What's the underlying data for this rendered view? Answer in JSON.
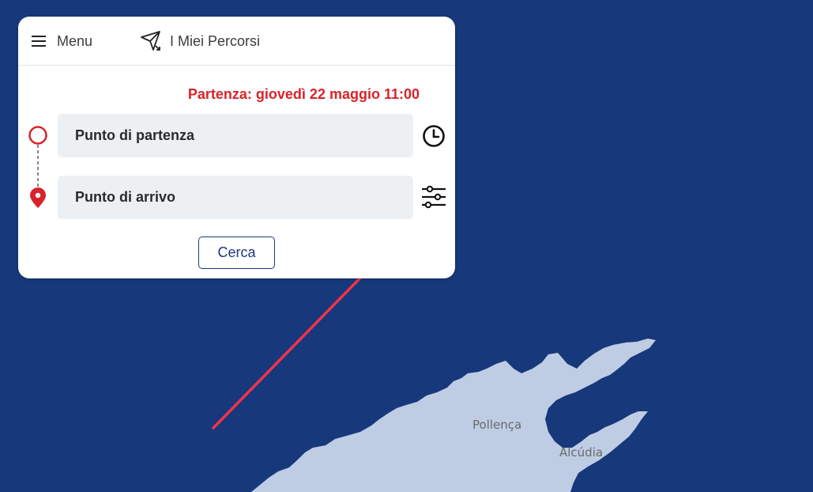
{
  "header": {
    "menu_label": "Menu",
    "menu_icon": "hamburger-icon",
    "routes_label": "I Miei Percorsi",
    "routes_icon": "send-arrow-icon"
  },
  "departure": {
    "text": "Partenza: giovedì 22 maggio 11:00"
  },
  "inputs": {
    "start_placeholder": "Punto di partenza",
    "end_placeholder": "Punto di arrivo"
  },
  "actions": {
    "search_label": "Cerca",
    "clock_icon": "clock-icon",
    "filters_icon": "sliders-icon"
  },
  "map": {
    "labels": [
      "Pollença",
      "Alcúdia"
    ]
  },
  "colors": {
    "accent_red": "#d8232a",
    "brand_blue": "#1d3a7d",
    "sea": "#17387a",
    "land": "#bfcde4",
    "annotation_arrow": "#f2334a"
  }
}
